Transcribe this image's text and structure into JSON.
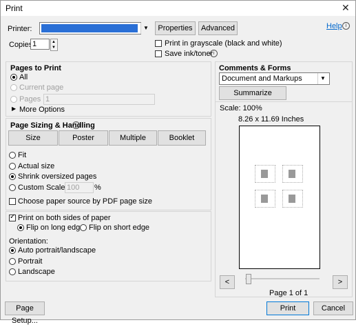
{
  "window": {
    "title": "Print"
  },
  "printer": {
    "label": "Printer:",
    "properties_label": "Properties",
    "advanced_label": "Advanced",
    "help_label": "Help"
  },
  "copies": {
    "label": "Copies:",
    "value": "1"
  },
  "options": {
    "grayscale_label": "Print in grayscale (black and white)",
    "save_ink_label": "Save ink/toner"
  },
  "pages_to_print": {
    "title": "Pages to Print",
    "all_label": "All",
    "current_label": "Current page",
    "pages_label": "Pages",
    "pages_value": "1",
    "more_options_label": "More Options"
  },
  "sizing": {
    "title": "Page Sizing & Handling",
    "size_label": "Size",
    "poster_label": "Poster",
    "multiple_label": "Multiple",
    "booklet_label": "Booklet",
    "fit_label": "Fit",
    "actual_label": "Actual size",
    "shrink_label": "Shrink oversized pages",
    "custom_label": "Custom Scale:",
    "custom_value": "100",
    "custom_unit": "%",
    "paper_source_label": "Choose paper source by PDF page size"
  },
  "duplex": {
    "both_sides_label": "Print on both sides of paper",
    "long_edge_label": "Flip on long edge",
    "short_edge_label": "Flip on short edge"
  },
  "orientation": {
    "title": "Orientation:",
    "auto_label": "Auto portrait/landscape",
    "portrait_label": "Portrait",
    "landscape_label": "Landscape"
  },
  "comments": {
    "title": "Comments & Forms",
    "selected": "Document and Markups",
    "summarize_label": "Summarize Comments"
  },
  "preview": {
    "scale": "Scale: 100%",
    "paper_size": "8.26 x 11.69 Inches",
    "page_indicator": "Page 1 of 1",
    "prev_label": "<",
    "next_label": ">"
  },
  "footer": {
    "page_setup_label": "Page Setup...",
    "print_label": "Print",
    "cancel_label": "Cancel"
  }
}
